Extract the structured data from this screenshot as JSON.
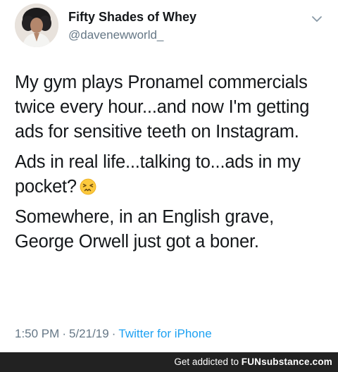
{
  "tweet": {
    "display_name": "Fifty Shades of Whey",
    "handle": "@davenewworld_",
    "paragraphs": [
      "My gym plays Pronamel commercials twice every hour...and now I'm getting ads for sensitive teeth on Instagram.",
      "Ads in real life...talking to...ads in my pocket?",
      "Somewhere, in an English grave, George Orwell just got a boner."
    ],
    "emoji": "confounded-face",
    "time": "1:50 PM",
    "separator": "·",
    "date": "5/21/19",
    "source": "Twitter for iPhone"
  },
  "footer": {
    "text": "Get addicted to",
    "brand_part1": "FUN",
    "brand_part2": "substance",
    "brand_part3": ".com"
  },
  "colors": {
    "link": "#1da1f2",
    "muted": "#657786",
    "text": "#14171a",
    "footer_bg": "#222222"
  }
}
